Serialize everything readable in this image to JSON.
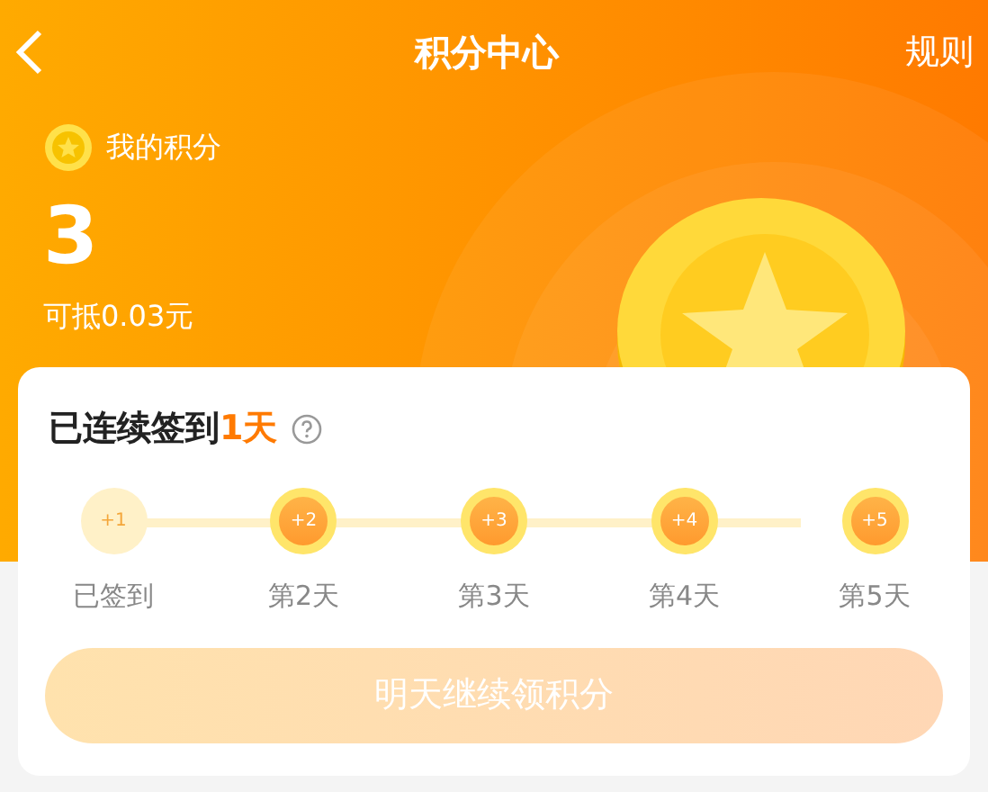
{
  "nav": {
    "title": "积分中心",
    "rules": "规则"
  },
  "points": {
    "label": "我的积分",
    "value": "3",
    "worth": "可抵0.03元"
  },
  "checkin": {
    "title": "已连续签到",
    "streak": "1天",
    "days": [
      {
        "bonus": "+1",
        "label": "已签到",
        "signed": true
      },
      {
        "bonus": "+2",
        "label": "第2天",
        "signed": false
      },
      {
        "bonus": "+3",
        "label": "第3天",
        "signed": false
      },
      {
        "bonus": "+4",
        "label": "第4天",
        "signed": false
      },
      {
        "bonus": "+5",
        "label": "第5天",
        "signed": false
      }
    ],
    "button": {
      "label": "明天继续领积分",
      "disabled": true
    }
  }
}
